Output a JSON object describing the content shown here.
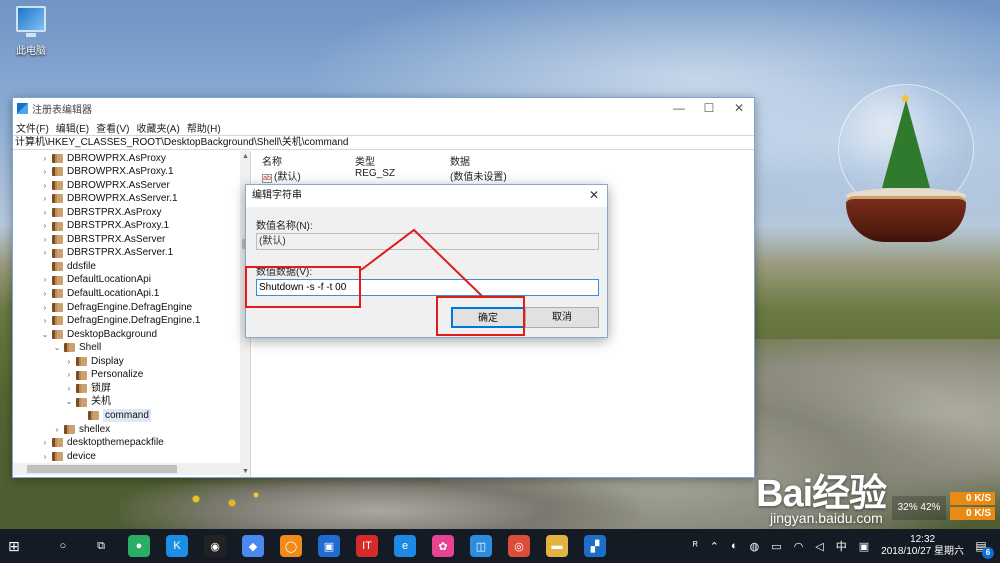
{
  "desktop": {
    "icon_label": "此电脑"
  },
  "window": {
    "title": "注册表编辑器",
    "controls": {
      "minimize": "—",
      "maximize": "☐",
      "close": "✕"
    },
    "menu": [
      "文件(F)",
      "编辑(E)",
      "查看(V)",
      "收藏夹(A)",
      "帮助(H)"
    ],
    "address": "计算机\\HKEY_CLASSES_ROOT\\DesktopBackground\\Shell\\关机\\command",
    "tree": [
      {
        "label": "DBROWPRX.AsProxy",
        "depth": 0,
        "twisty": "›"
      },
      {
        "label": "DBROWPRX.AsProxy.1",
        "depth": 0,
        "twisty": "›"
      },
      {
        "label": "DBROWPRX.AsServer",
        "depth": 0,
        "twisty": "›"
      },
      {
        "label": "DBROWPRX.AsServer.1",
        "depth": 0,
        "twisty": "›"
      },
      {
        "label": "DBRSTPRX.AsProxy",
        "depth": 0,
        "twisty": "›"
      },
      {
        "label": "DBRSTPRX.AsProxy.1",
        "depth": 0,
        "twisty": "›"
      },
      {
        "label": "DBRSTPRX.AsServer",
        "depth": 0,
        "twisty": "›"
      },
      {
        "label": "DBRSTPRX.AsServer.1",
        "depth": 0,
        "twisty": "›"
      },
      {
        "label": "ddsfile",
        "depth": 0,
        "twisty": ""
      },
      {
        "label": "DefaultLocationApi",
        "depth": 0,
        "twisty": "›"
      },
      {
        "label": "DefaultLocationApi.1",
        "depth": 0,
        "twisty": "›"
      },
      {
        "label": "DefragEngine.DefragEngine",
        "depth": 0,
        "twisty": "›"
      },
      {
        "label": "DefragEngine.DefragEngine.1",
        "depth": 0,
        "twisty": "›"
      },
      {
        "label": "DesktopBackground",
        "depth": 0,
        "twisty": "⌄"
      },
      {
        "label": "Shell",
        "depth": 1,
        "twisty": "⌄"
      },
      {
        "label": "Display",
        "depth": 2,
        "twisty": "›"
      },
      {
        "label": "Personalize",
        "depth": 2,
        "twisty": "›"
      },
      {
        "label": "锁屏",
        "depth": 2,
        "twisty": "›"
      },
      {
        "label": "关机",
        "depth": 2,
        "twisty": "⌄"
      },
      {
        "label": "command",
        "depth": 3,
        "twisty": "",
        "selected": true
      },
      {
        "label": "shellex",
        "depth": 1,
        "twisty": "›"
      },
      {
        "label": "desktopthemepackfile",
        "depth": 0,
        "twisty": "›"
      },
      {
        "label": "device",
        "depth": 0,
        "twisty": "›"
      }
    ],
    "list": {
      "headers": {
        "name": "名称",
        "type": "类型",
        "data": "数据"
      },
      "rows": [
        {
          "icon": "ab",
          "name": "(默认)",
          "type": "REG_SZ",
          "data": "(数值未设置)"
        }
      ]
    }
  },
  "dialog": {
    "title": "编辑字符串",
    "close": "✕",
    "name_label": "数值名称(N):",
    "name_value": "(默认)",
    "data_label": "数值数据(V):",
    "data_value": "Shutdown -s -f -t 00",
    "ok_label": "确定",
    "cancel_label": "取消"
  },
  "watermark": {
    "brand": "Bai经验",
    "url": "jingyan.baidu.com"
  },
  "netspeed": {
    "up": "0 K/S",
    "down": "0 K/S",
    "pct": "32%  42%"
  },
  "taskbar": {
    "apps": [
      {
        "name": "wechat-icon",
        "glyph": "●",
        "color": "#2aae67"
      },
      {
        "name": "kuaiya-icon",
        "glyph": "K",
        "color": "#1a8fe3"
      },
      {
        "name": "qq-icon",
        "glyph": "◉",
        "color": "#222222"
      },
      {
        "name": "dingtalk-icon",
        "glyph": "◆",
        "color": "#4a8af0"
      },
      {
        "name": "ring-app-icon",
        "glyph": "◯",
        "color": "#f28a1a"
      },
      {
        "name": "office-icon",
        "glyph": "▣",
        "color": "#1f6bd1"
      },
      {
        "name": "it-app-icon",
        "glyph": "IT",
        "color": "#d62b2b"
      },
      {
        "name": "ie-icon",
        "glyph": "e",
        "color": "#1e88e5"
      },
      {
        "name": "color-app-icon",
        "glyph": "✿",
        "color": "#e84393"
      },
      {
        "name": "store-icon",
        "glyph": "◫",
        "color": "#2a8de0"
      },
      {
        "name": "chrome-icon",
        "glyph": "◎",
        "color": "#dd4b39"
      },
      {
        "name": "explorer-icon",
        "glyph": "▬",
        "color": "#e3b341"
      },
      {
        "name": "regedit-icon",
        "glyph": "▞",
        "color": "#1b6fc8"
      }
    ],
    "tray_ime": "中",
    "time": "12:32",
    "date": "2018/10/27 星期六",
    "notification_count": "6"
  }
}
